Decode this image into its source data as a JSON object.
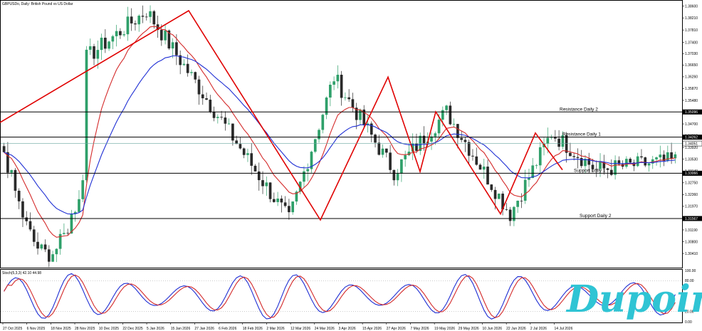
{
  "chart_data": {
    "type": "candlestick",
    "title": "GBPUSDo, Daily: British Pound vs US Dollar",
    "ylim": [
      1.2994,
      1.3878
    ],
    "price_ticks": [
      "1.38600",
      "1.38210",
      "1.37810",
      "1.37400",
      "1.37030",
      "1.36650",
      "1.36260",
      "1.35870",
      "1.35480",
      "1.35096",
      "1.34700",
      "1.34310",
      "1.33920",
      "1.33530",
      "1.33140",
      "1.32750",
      "1.32360",
      "1.31970",
      "1.31567",
      "1.31190",
      "1.30800",
      "1.30410"
    ],
    "date_ticks": [
      "27 Oct 2025",
      "6 Nov 2025",
      "18 Nov 2025",
      "28 Nov 2025",
      "10 Dec 2025",
      "22 Dec 2025",
      "5 Jan 2026",
      "15 Jan 2026",
      "27 Jan 2026",
      "6 Feb 2026",
      "18 Feb 2026",
      "2 Mar 2026",
      "12 Mar 2026",
      "24 Mar 2026",
      "3 Apr 2026",
      "15 Apr 2026",
      "27 Apr 2026",
      "7 May 2026",
      "19 May 2026",
      "29 May 2026",
      "10 Jun 2026",
      "22 Jun 2026",
      "2 Jul 2026",
      "14 Jul 2026"
    ],
    "levels": [
      {
        "name": "Resistance Daily 2",
        "price": 1.35096,
        "tag": "1.35096"
      },
      {
        "name": "Resistance Daily 1",
        "price": 1.34262,
        "tag": "1.34262"
      },
      {
        "name": "Support Daily 1",
        "price": 1.33066,
        "tag": "1.33066"
      },
      {
        "name": "Support Daily 2",
        "price": 1.31567,
        "tag": "1.31567"
      }
    ],
    "current_price": {
      "price": 1.34051,
      "tag": "1.34051"
    },
    "pivots": [
      1.3475,
      1.3845,
      1.3152,
      1.3625,
      1.3312,
      1.351,
      1.3172,
      1.344,
      1.3318
    ],
    "stoch": {
      "label": "Stoch(5,3,3) 42.10 44.98",
      "ylim": [
        0,
        100
      ],
      "ticks": [
        "100.00",
        "80.00",
        "20.00",
        "0.00"
      ]
    },
    "colors": {
      "bull": "#2fa06a",
      "bear": "#2a2a2a",
      "ma_fast": "#d42a2a",
      "ma_slow": "#1f2fd4",
      "trend": "#e00000",
      "level": "#000000"
    }
  },
  "brand": {
    "logo_text": "Dupoin"
  }
}
